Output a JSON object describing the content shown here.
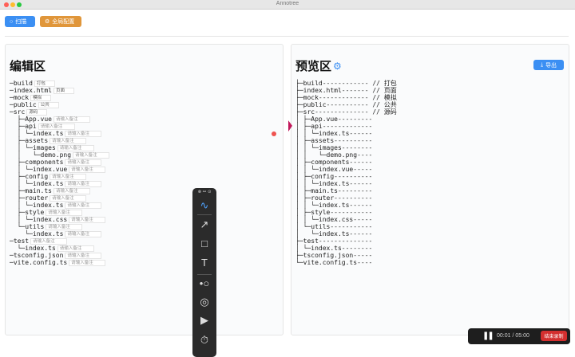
{
  "window": {
    "title": "Annotree"
  },
  "toolbar_top": {
    "scan_label": "扫描",
    "config_label": "全局配置"
  },
  "left_panel": {
    "title": "编辑区",
    "rows": [
      {
        "text": "─build",
        "note": "打包"
      },
      {
        "text": "─index.html",
        "note": "页面"
      },
      {
        "text": "─mock",
        "note": "模拟"
      },
      {
        "text": "─public",
        "note": "公共"
      },
      {
        "text": "─src",
        "note": "源码"
      },
      {
        "text": "  ├─App.vue",
        "note": "请输入备注"
      },
      {
        "text": "  ├─api",
        "note": "请输入备注"
      },
      {
        "text": "  │ └─index.ts",
        "note": "请输入备注"
      },
      {
        "text": "  ├─assets",
        "note": "请输入备注"
      },
      {
        "text": "  │ └─images",
        "note": "请输入备注"
      },
      {
        "text": "  │   └─demo.png",
        "note": "请输入备注"
      },
      {
        "text": "  ├─components",
        "note": "请输入备注"
      },
      {
        "text": "  │ └─index.vue",
        "note": "请输入备注"
      },
      {
        "text": "  ├─config",
        "note": "请输入备注"
      },
      {
        "text": "  │ └─index.ts",
        "note": "请输入备注"
      },
      {
        "text": "  ├─main.ts",
        "note": "请输入备注"
      },
      {
        "text": "  ├─router",
        "note": "请输入备注"
      },
      {
        "text": "  │ └─index.ts",
        "note": "请输入备注"
      },
      {
        "text": "  ├─style",
        "note": "请输入备注"
      },
      {
        "text": "  │ └─index.css",
        "note": "请输入备注"
      },
      {
        "text": "  └─utils",
        "note": "请输入备注"
      },
      {
        "text": "    └─index.ts",
        "note": "请输入备注"
      },
      {
        "text": "─test",
        "note": "请输入备注"
      },
      {
        "text": "  └─index.ts",
        "note": "请输入备注"
      },
      {
        "text": "─tsconfig.json",
        "note": "请输入备注"
      },
      {
        "text": "─vite.config.ts",
        "note": "请输入备注"
      }
    ]
  },
  "right_panel": {
    "title": "预览区",
    "export_label": "导出",
    "lines": [
      "├─build------------ // 打包",
      "├─index.html------- // 页面",
      "├─mock------------- // 模拟",
      "├─public----------- // 公共",
      "├─src-------------- // 源码",
      "│ ├─App.vue---------",
      "│ ├─api-------------",
      "│ │ └─index.ts------",
      "│ ├─assets----------",
      "│ │ └─images--------",
      "│ │   └─demo.png----",
      "│ ├─components------",
      "│ │ └─index.vue-----",
      "│ ├─config----------",
      "│ │ └─index.ts------",
      "│ ├─main.ts---------",
      "│ ├─router----------",
      "│ │ └─index.ts------",
      "│ ├─style-----------",
      "│ │ └─index.css-----",
      "│ └─utils-----------",
      "│   └─index.ts------",
      "├─test--------------",
      "│ └─index.ts--------",
      "├─tsconfig.json-----",
      "└─vite.config.ts----"
    ]
  },
  "recorder": {
    "time": "00:01 / 05:00",
    "end_label": "结束录制"
  },
  "colors": {
    "primary": "#3b8ff3",
    "warning": "#e0963a",
    "danger": "#d32f2f"
  }
}
